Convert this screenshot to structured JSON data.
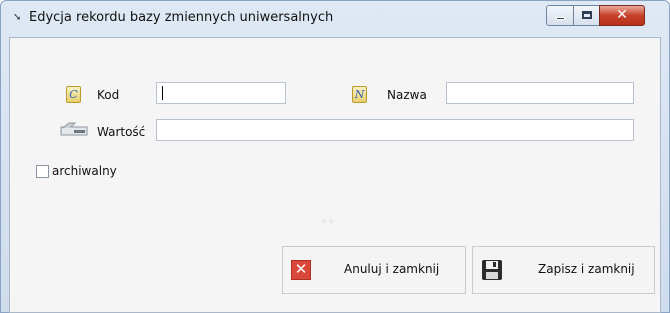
{
  "window": {
    "title": "Edycja rekordu bazy zmiennych uniwersalnych"
  },
  "form": {
    "kod_label": "Kod",
    "kod_value": "",
    "nazwa_label": "Nazwa",
    "nazwa_value": "",
    "wartosc_label": "Wartość",
    "wartosc_value": "",
    "archiwalny_label": "archiwalny",
    "archiwalny_checked": false
  },
  "buttons": {
    "cancel_label": "Anuluj i zamknij",
    "save_label": "Zapisz i zamknij"
  },
  "icons": {
    "window": "window-menu-icon",
    "kod": "letter-c-icon",
    "nazwa": "letter-n-icon",
    "wartosc": "value-card-icon",
    "cancel": "red-x-icon",
    "save": "floppy-disk-icon"
  }
}
